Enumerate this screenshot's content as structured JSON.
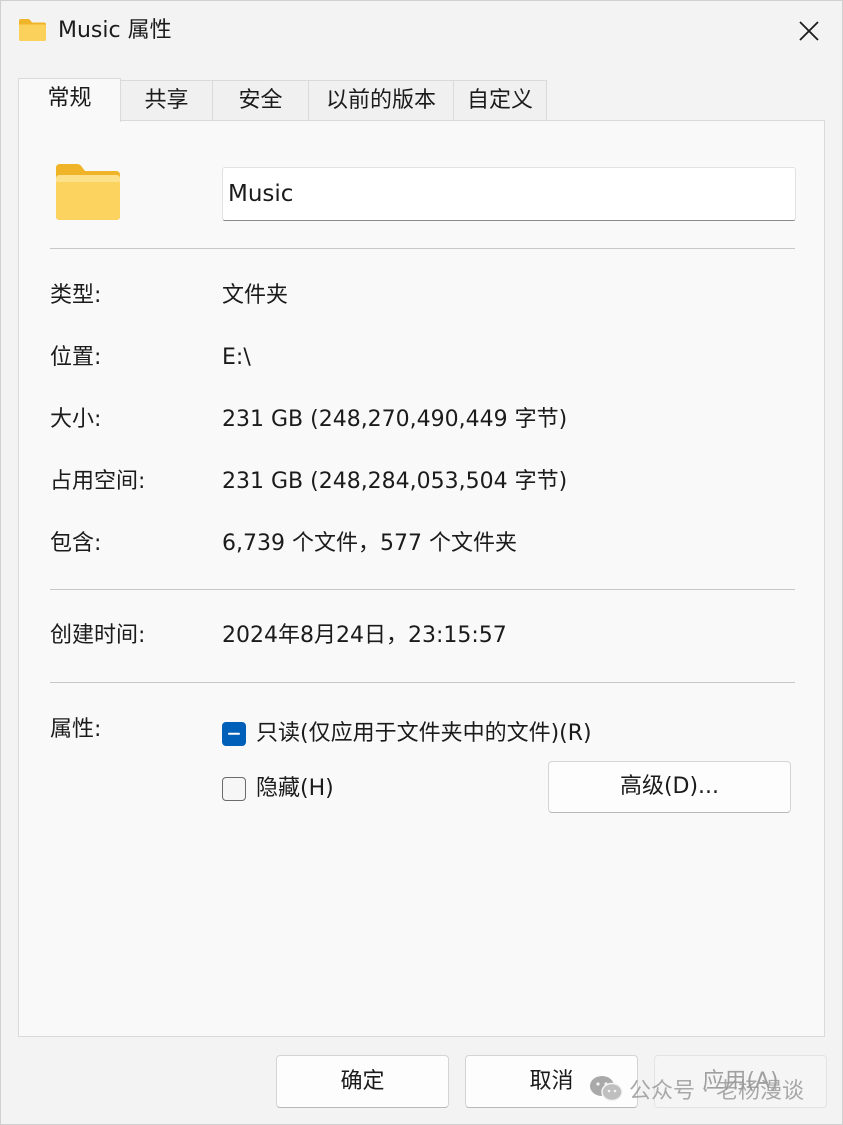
{
  "window": {
    "title": "Music 属性",
    "close_icon": "close-icon"
  },
  "tabs": [
    {
      "label": "常规",
      "active": true
    },
    {
      "label": "共享",
      "active": false
    },
    {
      "label": "安全",
      "active": false
    },
    {
      "label": "以前的版本",
      "active": false
    },
    {
      "label": "自定义",
      "active": false
    }
  ],
  "general": {
    "folder_icon": "folder-icon",
    "name_value": "Music",
    "properties": [
      {
        "label": "类型:",
        "value": "文件夹"
      },
      {
        "label": "位置:",
        "value": "E:\\"
      },
      {
        "label": "大小:",
        "value": "231 GB (248,270,490,449 字节)"
      },
      {
        "label": "占用空间:",
        "value": "231 GB (248,284,053,504 字节)"
      },
      {
        "label": "包含:",
        "value": "6,739 个文件，577 个文件夹"
      }
    ],
    "created": {
      "label": "创建时间:",
      "value": "2024年8月24日，23:15:57"
    },
    "attributes": {
      "label": "属性:",
      "readonly_label": "只读(仅应用于文件夹中的文件)(R)",
      "readonly_state": "indeterminate",
      "hidden_label": "隐藏(H)",
      "hidden_state": "unchecked",
      "advanced_label": "高级(D)..."
    }
  },
  "footer": {
    "ok_label": "确定",
    "cancel_label": "取消",
    "apply_label": "应用(A)",
    "apply_enabled": false
  },
  "watermark": {
    "icon": "wechat-icon",
    "text": "公众号 · 老杨漫谈"
  },
  "colors": {
    "accent": "#005fb8",
    "folder": "#f8c94a"
  }
}
